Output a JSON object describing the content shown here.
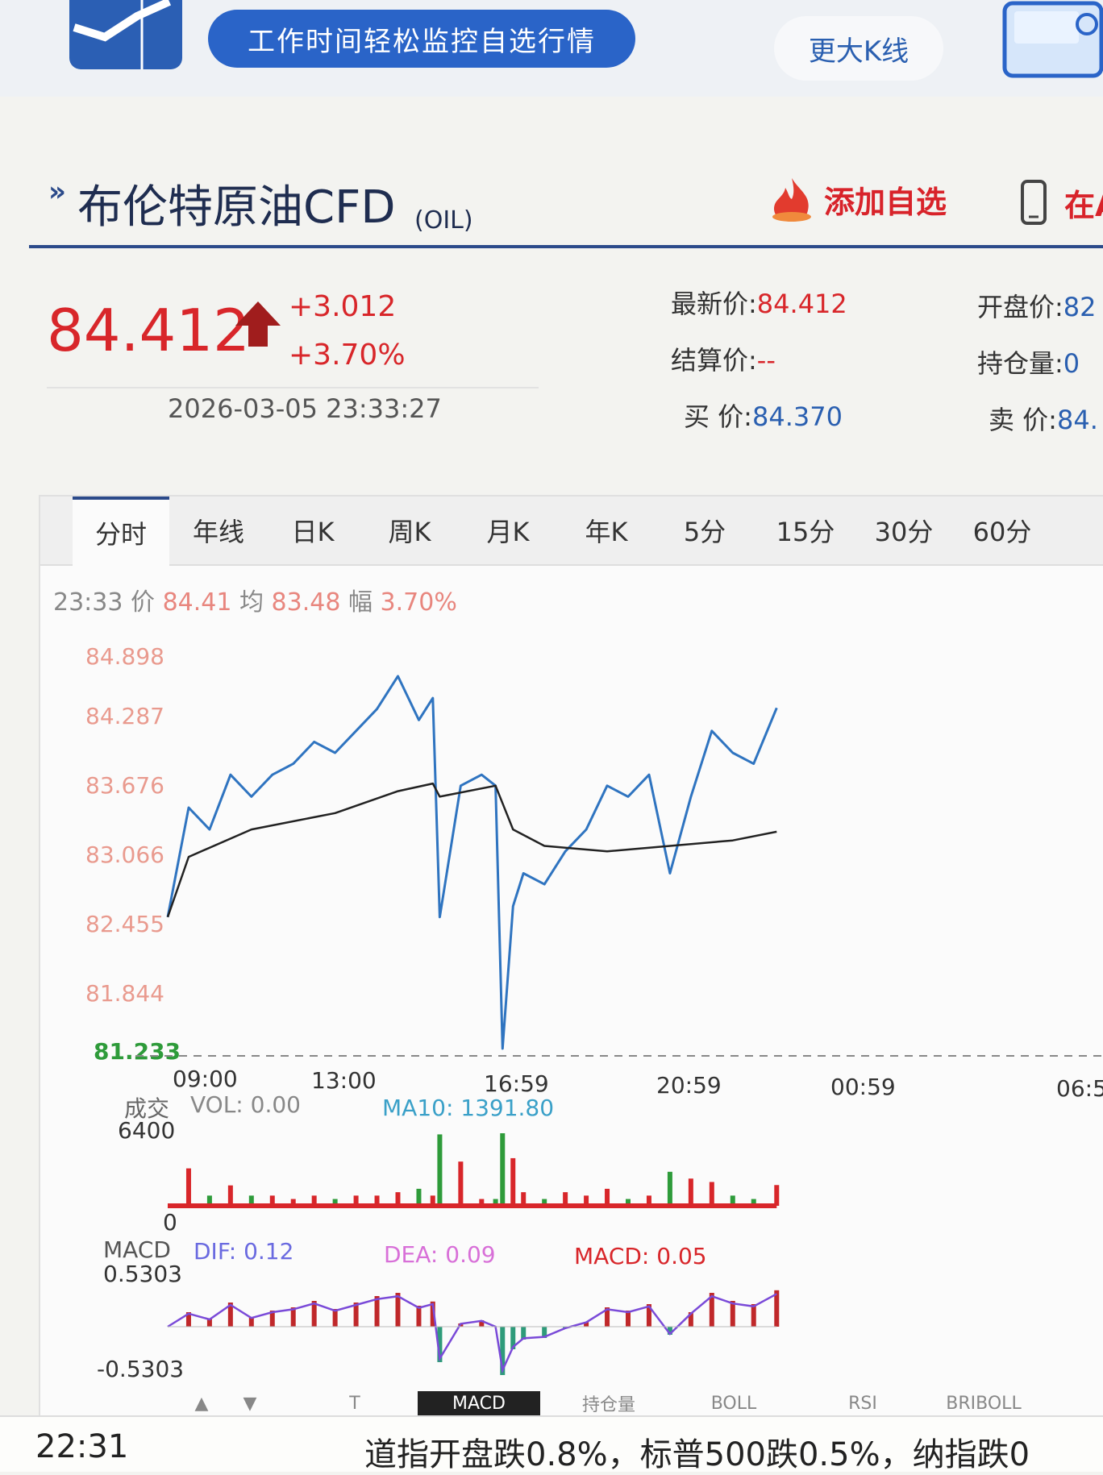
{
  "banner": {
    "promo_text": "工作时间轻松监控自选行情",
    "bigk_label": "更大K线"
  },
  "header": {
    "title": "布伦特原油CFD",
    "code": "(OIL)",
    "add_fav_label": "添加自选",
    "app_label": "在AP"
  },
  "quote": {
    "price": "84.412",
    "change": "+3.012",
    "change_pct": "+3.70%",
    "timestamp": "2026-03-05 23:33:27",
    "latest_label": "最新价:",
    "latest_value": "84.412",
    "settle_label": "结算价:",
    "settle_value": "--",
    "bid_label": "买  价:",
    "bid_value": "84.370",
    "open_label": "开盘价:",
    "open_value": "82",
    "oi_label": "持仓量:",
    "oi_value": "0",
    "ask_label": "卖  价:",
    "ask_value": "84."
  },
  "tabs": [
    "分时",
    "年线",
    "日K",
    "周K",
    "月K",
    "年K",
    "5分",
    "15分",
    "30分",
    "60分"
  ],
  "info": {
    "time": "23:33",
    "price_label": "价",
    "price": "84.41",
    "avg_label": "均",
    "avg": "83.48",
    "amp_label": "幅",
    "amp": "3.70%"
  },
  "chart_data": {
    "type": "line",
    "title": "",
    "y_ticks": [
      "84.898",
      "84.287",
      "83.676",
      "83.066",
      "82.455",
      "81.844",
      "81.233"
    ],
    "ylim": [
      81.233,
      84.898
    ],
    "x_ticks": [
      "09:00",
      "13:00",
      "16:59",
      "20:59",
      "00:59",
      "06:5"
    ],
    "series": [
      {
        "name": "价",
        "color": "#2f74c0",
        "x": [
          "09:00",
          "09:30",
          "10:00",
          "10:30",
          "11:00",
          "11:30",
          "12:00",
          "12:30",
          "13:00",
          "13:30",
          "14:00",
          "14:30",
          "15:00",
          "15:20",
          "15:30",
          "16:00",
          "16:30",
          "16:50",
          "17:00",
          "17:15",
          "17:30",
          "18:00",
          "18:30",
          "19:00",
          "19:30",
          "20:00",
          "20:30",
          "21:00",
          "21:30",
          "22:00",
          "22:30",
          "23:00",
          "23:33"
        ],
        "values": [
          82.5,
          83.5,
          83.3,
          83.8,
          83.6,
          83.8,
          83.9,
          84.1,
          84.0,
          84.2,
          84.4,
          84.7,
          84.3,
          84.5,
          82.5,
          83.7,
          83.8,
          83.7,
          81.3,
          82.6,
          82.9,
          82.8,
          83.1,
          83.3,
          83.7,
          83.6,
          83.8,
          82.9,
          83.6,
          84.2,
          84.0,
          83.9,
          84.41
        ]
      },
      {
        "name": "均",
        "color": "#222222",
        "x": [
          "09:00",
          "09:30",
          "11:00",
          "13:00",
          "14:30",
          "15:20",
          "15:30",
          "16:50",
          "17:15",
          "18:00",
          "19:30",
          "21:00",
          "22:30",
          "23:33"
        ],
        "values": [
          82.5,
          83.05,
          83.3,
          83.45,
          83.65,
          83.72,
          83.6,
          83.7,
          83.3,
          83.15,
          83.1,
          83.15,
          83.2,
          83.28
        ]
      }
    ],
    "volume": {
      "label": "成交",
      "vol_label": "VOL: 0.00",
      "ma_label": "MA10: 1391.80",
      "max_label": "6400",
      "zero_label": "0",
      "max": 6400
    },
    "macd": {
      "label": "MACD",
      "dif_label": "DIF: 0.12",
      "dea_label": "DEA: 0.09",
      "macd_label": "MACD: 0.05",
      "max_label": "0.5303",
      "min_label": "-0.5303"
    }
  },
  "subtabs": [
    "",
    "T",
    "MACD",
    "持仓量",
    "BOLL",
    "RSI",
    "BRIBOLL"
  ],
  "status": {
    "time": "22:31",
    "news": "道指开盘跌0.8%，标普500跌0.5%，纳指跌0"
  },
  "colors": {
    "up": "#d8262a",
    "brand": "#2b4a8a",
    "price_line": "#2f74c0",
    "avg_line": "#222222",
    "low_label": "#2e9b3a"
  }
}
